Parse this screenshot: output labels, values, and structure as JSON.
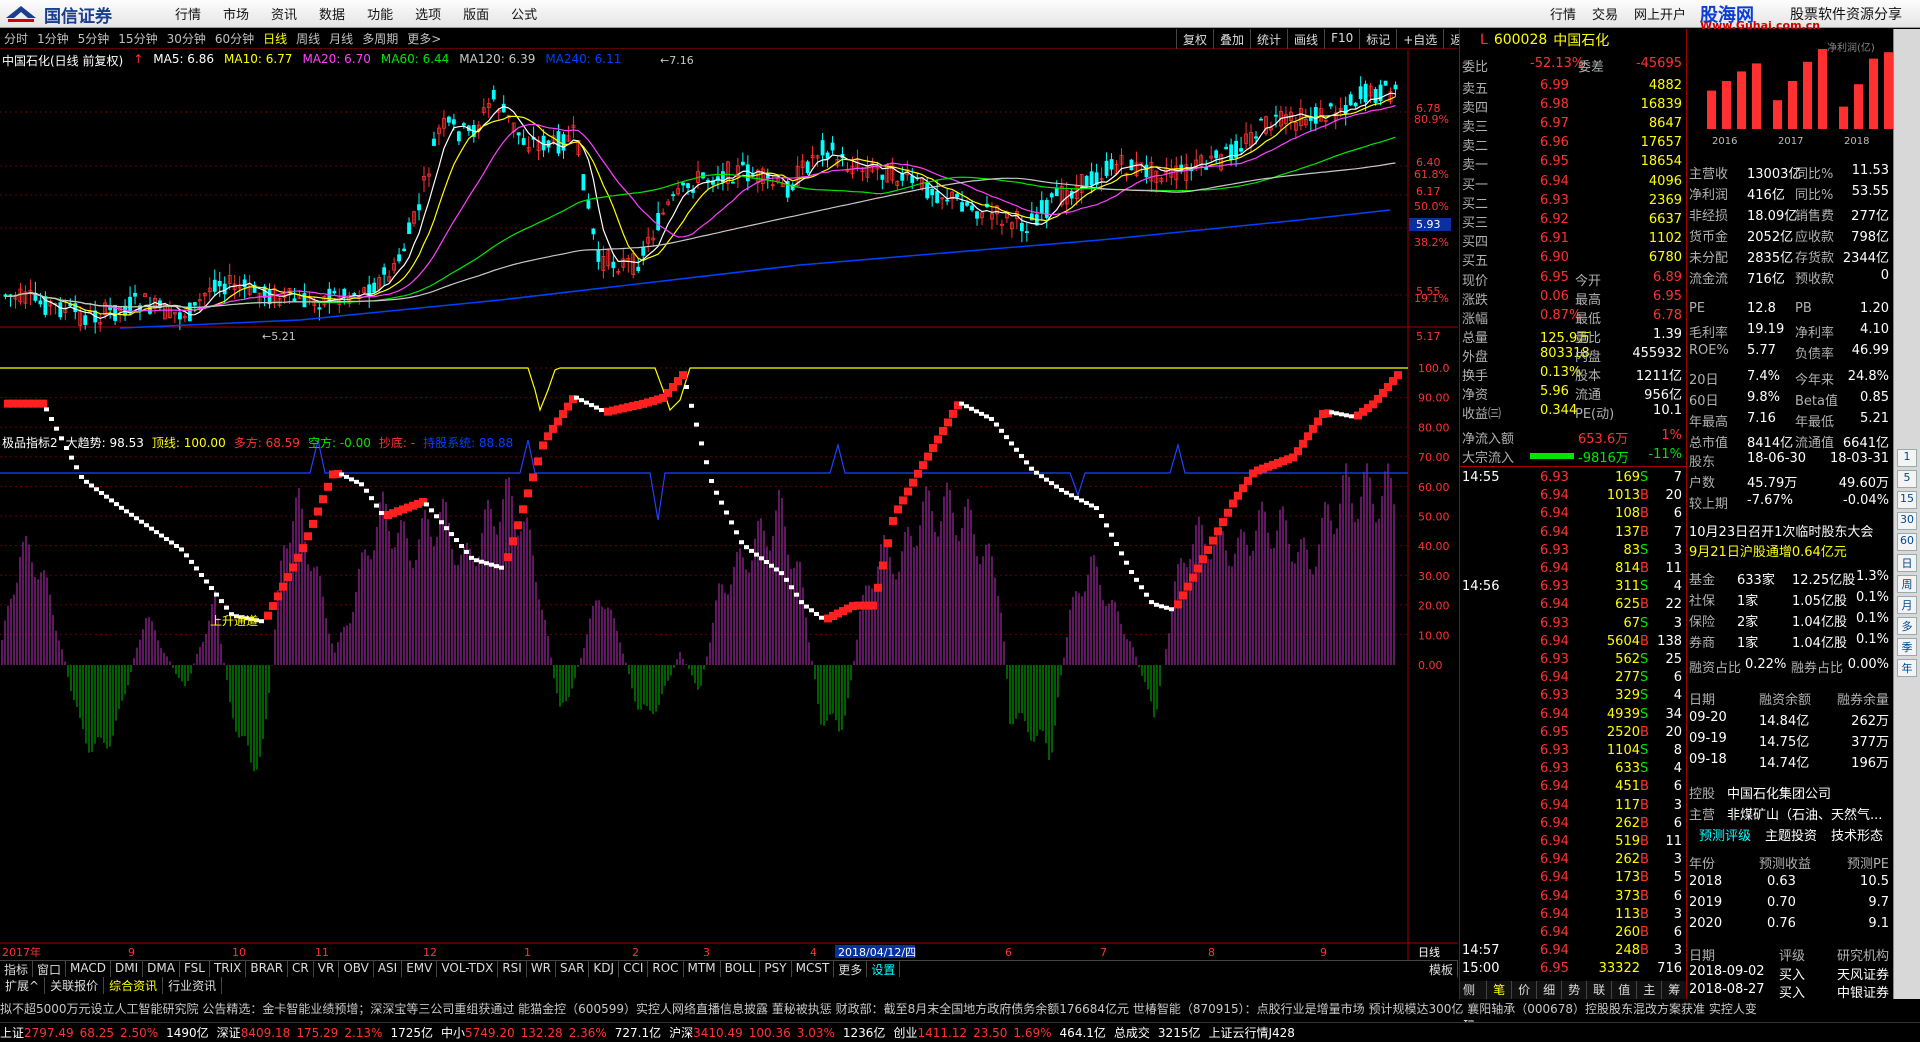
{
  "menubar": {
    "brand": "国信证券",
    "items": [
      "行情",
      "市场",
      "资讯",
      "数据",
      "功能",
      "选项",
      "版面",
      "公式"
    ],
    "right_items": [
      "行情",
      "交易",
      "网上开户"
    ],
    "ad_title": "股海网",
    "ad_subtitle": "股票软件资源分享",
    "ad_url": "Www.Guhai.com.cn"
  },
  "toolbar": {
    "periods": [
      "分时",
      "1分钟",
      "5分钟",
      "15分钟",
      "30分钟",
      "60分钟",
      "日线",
      "周线",
      "月线",
      "多周期",
      "更多>"
    ],
    "active": "日线",
    "right_buttons": [
      "复权",
      "叠加",
      "统计",
      "画线",
      "F10",
      "标记",
      "+自选",
      "返回"
    ]
  },
  "main_chart": {
    "title": "中国石化(日线 前复权)",
    "ma": [
      {
        "label": "MA5: 6.86",
        "color": "#ffffff"
      },
      {
        "label": "MA10: 6.77",
        "color": "#ffff00"
      },
      {
        "label": "MA20: 6.70",
        "color": "#ff40ff"
      },
      {
        "label": "MA60: 6.44",
        "color": "#00e600"
      },
      {
        "label": "MA120: 6.39",
        "color": "#c8c8c8"
      },
      {
        "label": "MA240: 6.11",
        "color": "#0040ff"
      }
    ],
    "price_axis": [
      "6.78",
      "6.40",
      "6.17",
      "5.93",
      "5.55",
      "5.17"
    ],
    "pct_axis": [
      "80.9%",
      "61.8%",
      "50.0%",
      "38.2%",
      "19.1%"
    ],
    "high_label": "7.16",
    "low_label": "5.21",
    "current_price_tag": "5.93"
  },
  "indicator": {
    "name": "极品指标2",
    "items": [
      {
        "label": "大趋势: 98.53",
        "color": "#ffffff"
      },
      {
        "label": "顶线: 100.00",
        "color": "#ffff00"
      },
      {
        "label": "多方: 68.59",
        "color": "#ff3232"
      },
      {
        "label": "空方: -0.00",
        "color": "#00e600"
      },
      {
        "label": "抄底: -",
        "color": "#ff3232"
      },
      {
        "label": "持股系统: 88.88",
        "color": "#0040ff"
      }
    ],
    "axis": [
      "100.0",
      "90.00",
      "80.00",
      "70.00",
      "60.00",
      "50.00",
      "40.00",
      "30.00",
      "20.00",
      "10.00",
      "0.00"
    ],
    "annotation": "上升通道"
  },
  "x_axis": {
    "labels": [
      "2017年",
      "9",
      "10",
      "11",
      "12",
      "1",
      "2",
      "3",
      "4",
      "2018/04/12/四",
      "6",
      "7",
      "8",
      "9"
    ],
    "right_label": "日线"
  },
  "bottom_tabs": [
    "指标",
    "窗口",
    "MACD",
    "DMI",
    "DMA",
    "FSL",
    "TRIX",
    "BRAR",
    "CR",
    "VR",
    "OBV",
    "ASI",
    "EMV",
    "VOL-TDX",
    "RSI",
    "WR",
    "SAR",
    "KDJ",
    "CCI",
    "ROC",
    "MTM",
    "BOLL",
    "PSY",
    "MCST",
    "更多",
    "设置"
  ],
  "bottom_tabs2": [
    "扩展^",
    "关联报价",
    "综合资讯",
    "行业资讯"
  ],
  "template_label": "模板",
  "quote": {
    "code": "600028",
    "name": "中国石化",
    "weibi": "-52.13%",
    "weicha": "-45695",
    "sells": [
      {
        "label": "卖五",
        "price": "6.99",
        "vol": "4882"
      },
      {
        "label": "卖四",
        "price": "6.98",
        "vol": "16839"
      },
      {
        "label": "卖三",
        "price": "6.97",
        "vol": "8647"
      },
      {
        "label": "卖二",
        "price": "6.96",
        "vol": "17657"
      },
      {
        "label": "卖一",
        "price": "6.95",
        "vol": "18654"
      }
    ],
    "buys": [
      {
        "label": "买一",
        "price": "6.94",
        "vol": "4096"
      },
      {
        "label": "买二",
        "price": "6.93",
        "vol": "2369"
      },
      {
        "label": "买三",
        "price": "6.92",
        "vol": "6637"
      },
      {
        "label": "买四",
        "price": "6.91",
        "vol": "1102"
      },
      {
        "label": "买五",
        "price": "6.90",
        "vol": "6780"
      }
    ],
    "stats": [
      [
        "现价",
        "6.95",
        "今开",
        "6.89"
      ],
      [
        "涨跌",
        "0.06",
        "最高",
        "6.95"
      ],
      [
        "涨幅",
        "0.87%",
        "最低",
        "6.78"
      ],
      [
        "总量",
        "125.9万",
        "量比",
        "1.39"
      ],
      [
        "外盘",
        "803318",
        "内盘",
        "455932"
      ],
      [
        "换手",
        "0.13%",
        "股本",
        "1211亿"
      ],
      [
        "净资",
        "5.96",
        "流通",
        "956亿"
      ],
      [
        "收益㈢",
        "0.344",
        "PE(动)",
        "10.1"
      ]
    ],
    "netflow": {
      "label": "净流入额",
      "value": "653.6万",
      "pct": "1%"
    },
    "bigflow": {
      "label": "大宗流入",
      "value": "-9816万",
      "pct": "-11%"
    },
    "ticks": [
      [
        "14:55",
        "6.93",
        "169",
        "S",
        "7"
      ],
      [
        "",
        "6.94",
        "1013",
        "B",
        "20"
      ],
      [
        "",
        "6.94",
        "108",
        "B",
        "6"
      ],
      [
        "",
        "6.94",
        "137",
        "B",
        "7"
      ],
      [
        "",
        "6.93",
        "83",
        "S",
        "3"
      ],
      [
        "",
        "6.94",
        "814",
        "B",
        "11"
      ],
      [
        "14:56",
        "6.93",
        "311",
        "S",
        "4"
      ],
      [
        "",
        "6.94",
        "625",
        "B",
        "22"
      ],
      [
        "",
        "6.93",
        "67",
        "S",
        "3"
      ],
      [
        "",
        "6.94",
        "5604",
        "B",
        "138"
      ],
      [
        "",
        "6.93",
        "562",
        "S",
        "25"
      ],
      [
        "",
        "6.94",
        "277",
        "S",
        "6"
      ],
      [
        "",
        "6.93",
        "329",
        "S",
        "4"
      ],
      [
        "",
        "6.94",
        "4939",
        "S",
        "34"
      ],
      [
        "",
        "6.95",
        "2520",
        "B",
        "20"
      ],
      [
        "",
        "6.93",
        "1104",
        "S",
        "8"
      ],
      [
        "",
        "6.93",
        "633",
        "S",
        "4"
      ],
      [
        "",
        "6.94",
        "451",
        "B",
        "6"
      ],
      [
        "",
        "6.94",
        "117",
        "B",
        "3"
      ],
      [
        "",
        "6.94",
        "262",
        "B",
        "6"
      ],
      [
        "",
        "6.94",
        "519",
        "B",
        "11"
      ],
      [
        "",
        "6.94",
        "262",
        "B",
        "3"
      ],
      [
        "",
        "6.94",
        "173",
        "B",
        "5"
      ],
      [
        "",
        "6.94",
        "373",
        "B",
        "6"
      ],
      [
        "",
        "6.94",
        "113",
        "B",
        "3"
      ],
      [
        "",
        "6.94",
        "260",
        "B",
        "6"
      ],
      [
        "14:57",
        "6.94",
        "248",
        "B",
        "3"
      ],
      [
        "15:00",
        "6.95",
        "33322",
        "",
        "716"
      ]
    ],
    "bottom_tabs": [
      "笔",
      "价",
      "细",
      "势",
      "联",
      "值",
      "主",
      "筹"
    ],
    "side_label": "侧边栏>>"
  },
  "f10": {
    "mini_chart_title": "净利润(亿)",
    "mini_years": [
      "2016",
      "2017",
      "2018"
    ],
    "mini_values": [
      24,
      30,
      36,
      41,
      18,
      30,
      42,
      50,
      14,
      28,
      44,
      48
    ],
    "rows": [
      [
        "主营收",
        "13003亿",
        "同比%",
        "11.53"
      ],
      [
        "净利润",
        "416亿",
        "同比%",
        "53.55"
      ],
      [
        "非经损",
        "18.09亿",
        "销售费",
        "277亿"
      ],
      [
        "货币金",
        "2052亿",
        "应收款",
        "798亿"
      ],
      [
        "未分配",
        "2835亿",
        "存货款",
        "2344亿"
      ],
      [
        "流金流",
        "716亿",
        "预收款",
        "0"
      ],
      [
        "PE",
        "12.8",
        "PB",
        "1.20"
      ],
      [
        "毛利率",
        "19.19",
        "净利率",
        "4.10"
      ],
      [
        "ROE%",
        "5.77",
        "负债率",
        "46.99"
      ],
      [
        "20日",
        "7.4%",
        "今年来",
        "24.8%"
      ],
      [
        "60日",
        "9.8%",
        "Beta值",
        "0.85"
      ],
      [
        "年最高",
        "7.16",
        "年最低",
        "5.21"
      ],
      [
        "总市值",
        "8414亿",
        "流通值",
        "6641亿"
      ],
      [
        "股东",
        "18-06-30",
        "",
        "18-03-31"
      ],
      [
        "户数",
        "45.79万",
        "",
        "49.60万"
      ],
      [
        "较上期",
        "-7.67%",
        "",
        "-0.04%"
      ]
    ],
    "news1": "10月23日召开1次临时股东大会",
    "news2": "9月21日沪股通增0.64亿元",
    "holders": [
      [
        "基金",
        "633家",
        "12.25亿股",
        "1.3%"
      ],
      [
        "社保",
        "1家",
        "1.05亿股",
        "0.1%"
      ],
      [
        "保险",
        "2家",
        "1.04亿股",
        "0.1%"
      ],
      [
        "券商",
        "1家",
        "1.04亿股",
        "0.1%"
      ]
    ],
    "margin": [
      "融资占比",
      "0.22%",
      "融券占比",
      "0.00%"
    ],
    "margin_head": [
      "日期",
      "融资余额",
      "融券余量"
    ],
    "margin_rows": [
      [
        "09-20",
        "14.84亿",
        "262万"
      ],
      [
        "09-19",
        "14.75亿",
        "377万"
      ],
      [
        "09-18",
        "14.74亿",
        "196万"
      ]
    ],
    "controller": [
      "控股",
      "中国石化集团公司"
    ],
    "business": [
      "主营",
      "非煤矿山（石油、天然气..."
    ],
    "tabs": [
      "预测评级",
      "主题投资",
      "技术形态"
    ],
    "forecast_head": [
      "年份",
      "预测收益",
      "预测PE"
    ],
    "forecast_rows": [
      [
        "2018",
        "0.63",
        "10.5"
      ],
      [
        "2019",
        "0.70",
        "9.7"
      ],
      [
        "2020",
        "0.76",
        "9.1"
      ]
    ],
    "rating_head": [
      "日期",
      "评级",
      "研究机构"
    ],
    "rating_rows": [
      [
        "2018-09-02",
        "买入",
        "天风证券"
      ],
      [
        "2018-08-27",
        "买入",
        "中银证券"
      ]
    ]
  },
  "right_bar": [
    "1",
    "5",
    "15",
    "30",
    "60",
    "日",
    "周",
    "月",
    "多",
    "季",
    "年"
  ],
  "ticker": "拟不超5000万元设立人工智能研究院    公告精选：金卡智能业绩预增；深深宝等三公司重组获通过    能猫金控（600599）实控人网络直播信息披露 董秘被执惩    财政部：截至8月末全国地方政府债务余额176684亿元    世椿智能（870915）：点胶行业是增量市场 预计规模达300亿    襄阳轴承（000678）控股股东混改方案获准 实控人变",
  "status": [
    {
      "name": "上证",
      "value": "2797.49",
      "chg": "68.25",
      "pct": "2.50%",
      "amt": "1490亿"
    },
    {
      "name": "深证",
      "value": "8409.18",
      "chg": "175.29",
      "pct": "2.13%",
      "amt": "1725亿"
    },
    {
      "name": "中小",
      "value": "5749.20",
      "chg": "132.28",
      "pct": "2.36%",
      "amt": "727.1亿"
    },
    {
      "name": "沪深",
      "value": "3410.49",
      "chg": "100.36",
      "pct": "3.03%",
      "amt": "1236亿"
    },
    {
      "name": "创业",
      "value": "1411.12",
      "chg": "23.50",
      "pct": "1.69%",
      "amt": "464.1亿"
    }
  ],
  "status_extra": [
    "总成交",
    "3215亿",
    "上证云行情J428"
  ]
}
